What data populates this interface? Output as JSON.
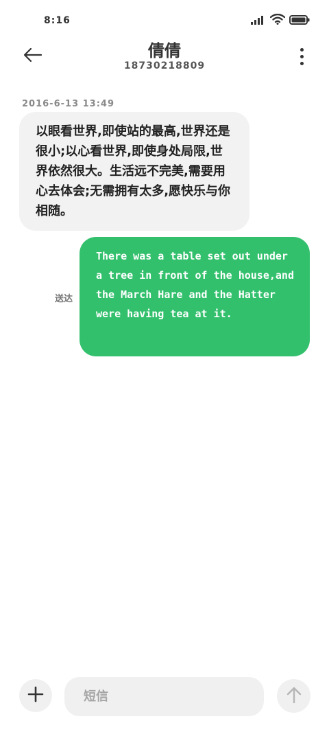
{
  "status_bar": {
    "time": "8:16",
    "icons": [
      "signal-icon",
      "wifi-icon",
      "battery-icon"
    ]
  },
  "header": {
    "title": "倩倩",
    "subtitle": "18730218809",
    "back_icon": "back-arrow-icon",
    "menu_icon": "more-vertical-icon"
  },
  "conversation": {
    "timestamp": "2016-6-13 13:49",
    "incoming": {
      "text": "以眼看世界,即使站的最高,世界还是很小;以心看世界,即使身处局限,世界依然很大。生活远不完美,需要用心去体会;无需拥有太多,愿快乐与你相随。"
    },
    "outgoing": {
      "text": "There was a table set out under a tree in front of the house,and the March Hare and the Hatter were having tea at it.",
      "status": "送达"
    }
  },
  "composer": {
    "placeholder": "短信",
    "value": "",
    "add_icon": "plus-icon",
    "send_icon": "arrow-up-icon"
  },
  "colors": {
    "outgoing_bubble": "#33c06d",
    "incoming_bubble": "#f2f2f2",
    "input_background": "#f0f0f0"
  }
}
